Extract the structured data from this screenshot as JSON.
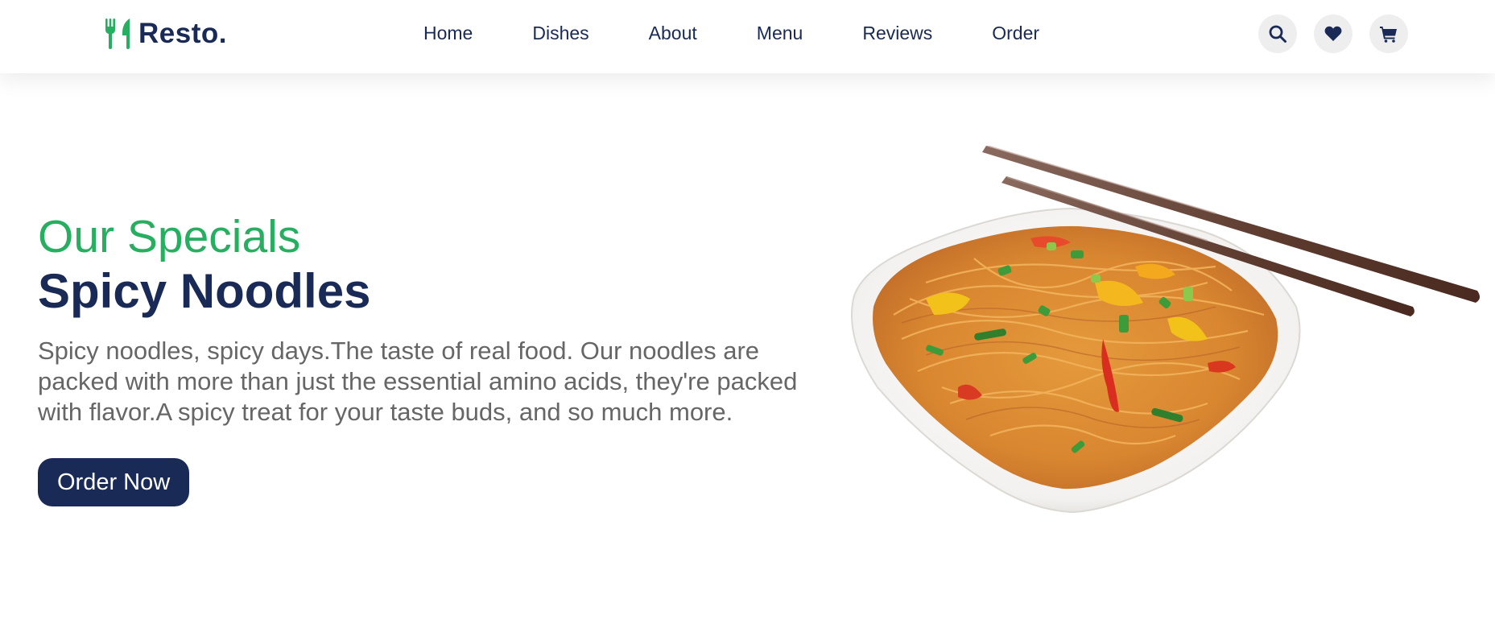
{
  "brand": {
    "name": "Resto.",
    "icon": "utensils-icon",
    "accent_color": "#27ae60",
    "primary_color": "#192a56"
  },
  "nav": {
    "items": [
      {
        "label": "Home"
      },
      {
        "label": "Dishes"
      },
      {
        "label": "About"
      },
      {
        "label": "Menu"
      },
      {
        "label": "Reviews"
      },
      {
        "label": "Order"
      }
    ]
  },
  "header_icons": [
    {
      "name": "search-icon"
    },
    {
      "name": "heart-icon"
    },
    {
      "name": "cart-icon"
    }
  ],
  "hero": {
    "subtitle": "Our Specials",
    "title": "Spicy Noodles",
    "description": "Spicy noodles, spicy days.The taste of real food. Our noodles are packed with more than just the essential amino acids, they're packed with flavor.A spicy treat for your taste buds, and so much more.",
    "button_label": "Order Now",
    "image_alt": "plate of spicy noodles with chopsticks"
  }
}
